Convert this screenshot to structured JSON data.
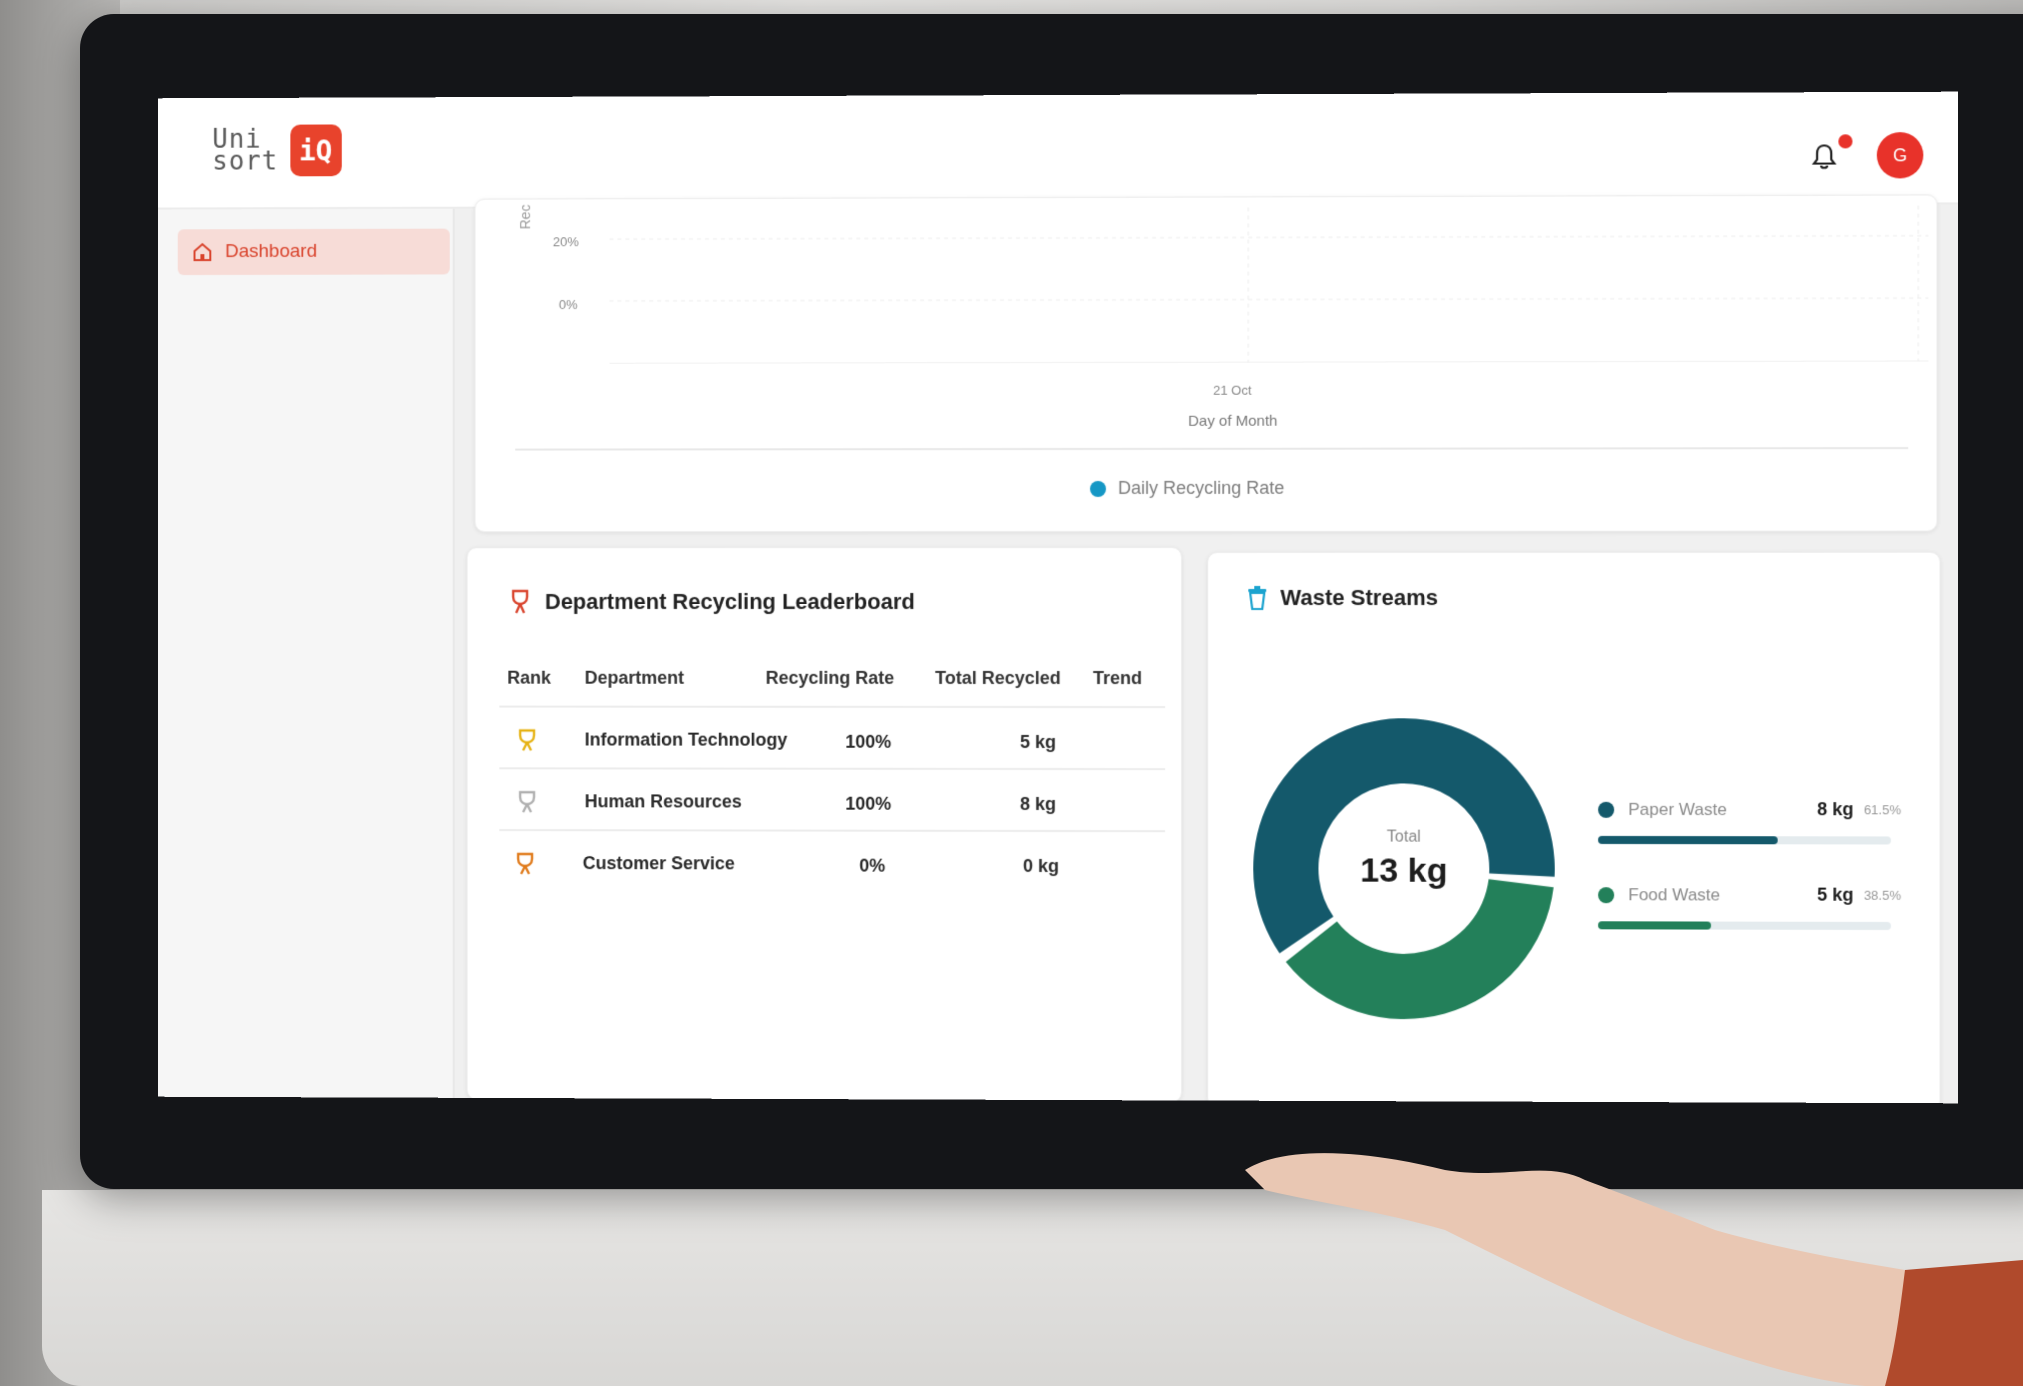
{
  "app": {
    "logo_line1": "Uni",
    "logo_line2": "sort",
    "logo_badge": "iQ",
    "avatar_initial": "G",
    "accent_color": "#e8432c"
  },
  "sidebar": {
    "items": [
      {
        "label": "Dashboard",
        "icon": "home-icon",
        "active": true
      }
    ]
  },
  "recycling_chart": {
    "y_title": "Rec",
    "y_ticks": [
      "20%",
      "0%"
    ],
    "x_tick": "21 Oct",
    "x_title": "Day of Month",
    "legend": "Daily Recycling Rate",
    "legend_color": "#1597c5"
  },
  "leaderboard": {
    "title": "Department Recycling Leaderboard",
    "icon": "trophy-icon",
    "columns": [
      "Rank",
      "Department",
      "Recycling Rate",
      "Total Recycled",
      "Trend"
    ],
    "rows": [
      {
        "rank_icon": "gold-trophy-icon",
        "department": "Information Technology",
        "rate": "100%",
        "total": "5 kg",
        "trend": ""
      },
      {
        "rank_icon": "silver-trophy-icon",
        "department": "Human Resources",
        "rate": "100%",
        "total": "8 kg",
        "trend": ""
      },
      {
        "rank_icon": "bronze-trophy-icon",
        "department": "Customer Service",
        "rate": "0%",
        "total": "0 kg",
        "trend": ""
      }
    ]
  },
  "waste_streams": {
    "title": "Waste Streams",
    "icon": "bin-icon",
    "total_label": "Total",
    "total_value": "13 kg",
    "streams": [
      {
        "name": "Paper Waste",
        "value": "8 kg",
        "percent": "61.5%",
        "fraction": 0.615,
        "color": "#14596b"
      },
      {
        "name": "Food Waste",
        "value": "5 kg",
        "percent": "38.5%",
        "fraction": 0.385,
        "color": "#23805a"
      }
    ]
  }
}
